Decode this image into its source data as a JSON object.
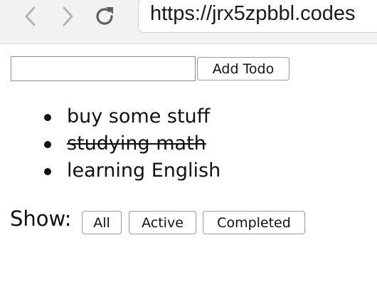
{
  "browser": {
    "url": "https://jrx5zpbbl.codes",
    "icons": {
      "back": "chevron-left-icon",
      "forward": "chevron-right-icon",
      "reload": "reload-icon"
    },
    "colors": {
      "chrome_bg": "#f2f2f2",
      "icon_disabled": "#b4b4b4",
      "icon_enabled": "#5f5f5f"
    }
  },
  "todo": {
    "input": {
      "value": "",
      "placeholder": ""
    },
    "add_button_label": "Add Todo",
    "items": [
      {
        "text": "buy some stuff",
        "completed": false
      },
      {
        "text": "studying math",
        "completed": true
      },
      {
        "text": "learning English",
        "completed": false
      }
    ]
  },
  "filters": {
    "label": "Show:",
    "all": "All",
    "active": "Active",
    "completed": "Completed"
  }
}
